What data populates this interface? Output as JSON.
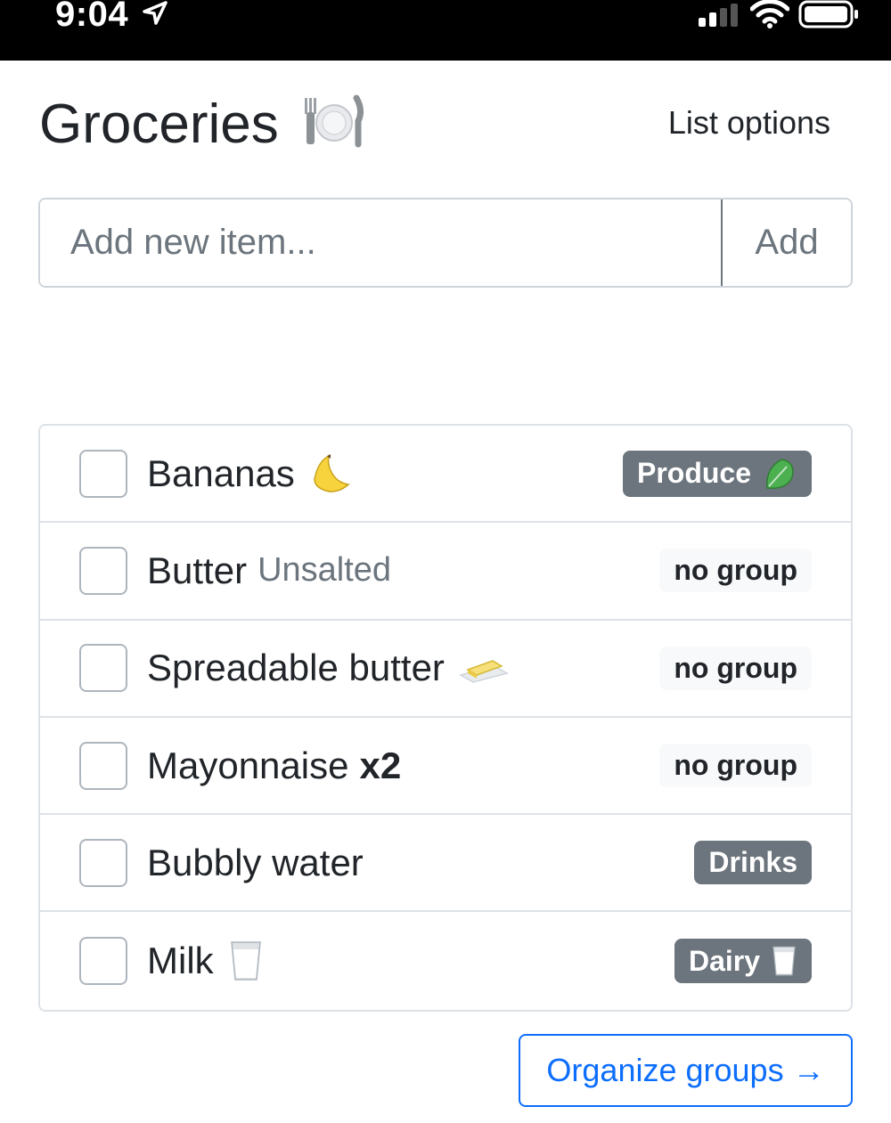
{
  "status_bar": {
    "time": "9:04",
    "icons": [
      "location-arrow-icon",
      "cellular-signal-icon",
      "wifi-icon",
      "battery-icon"
    ]
  },
  "header": {
    "title": "Groceries",
    "title_emoji": "fork-knife-plate-icon",
    "list_options_label": "List options"
  },
  "add_item": {
    "placeholder": "Add new item...",
    "value": "",
    "add_label": "Add"
  },
  "items": [
    {
      "name": "Bananas",
      "note": "",
      "quantity": "",
      "emoji": "banana-icon",
      "group": "Produce",
      "group_emoji": "leafy-greens-icon",
      "checked": false
    },
    {
      "name": "Butter",
      "note": "Unsalted",
      "quantity": "",
      "emoji": "",
      "group": "no group",
      "group_emoji": "",
      "checked": false
    },
    {
      "name": "Spreadable butter",
      "note": "",
      "quantity": "",
      "emoji": "butter-icon",
      "group": "no group",
      "group_emoji": "",
      "checked": false
    },
    {
      "name": "Mayonnaise",
      "note": "",
      "quantity": "x2",
      "emoji": "",
      "group": "no group",
      "group_emoji": "",
      "checked": false
    },
    {
      "name": "Bubbly water",
      "note": "",
      "quantity": "",
      "emoji": "",
      "group": "Drinks",
      "group_emoji": "",
      "checked": false
    },
    {
      "name": "Milk",
      "note": "",
      "quantity": "",
      "emoji": "milk-glass-icon",
      "group": "Dairy",
      "group_emoji": "milk-glass-icon",
      "checked": false
    }
  ],
  "footer": {
    "organize_label": "Organize groups →"
  },
  "colors": {
    "status_bar": "#000000",
    "badge_group": "#6c757d",
    "badge_none": "#f8f9fa",
    "primary": "#0d6efd",
    "text": "#212529",
    "muted": "#6c757d"
  }
}
